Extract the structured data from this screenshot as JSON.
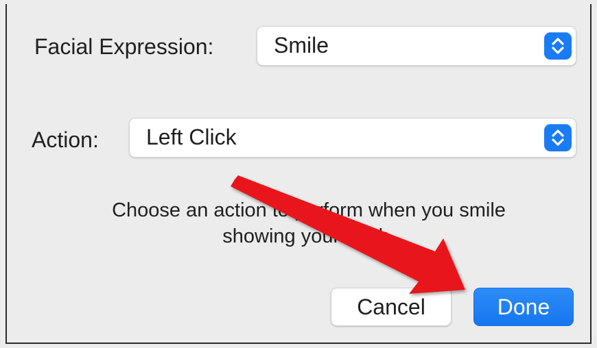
{
  "form": {
    "facial_expression_label": "Facial Expression:",
    "facial_expression_value": "Smile",
    "action_label": "Action:",
    "action_value": "Left Click",
    "description": "Choose an action to perform when you smile showing your teeth."
  },
  "buttons": {
    "cancel_label": "Cancel",
    "done_label": "Done"
  },
  "colors": {
    "accent": "#1a7cf5",
    "annotation_arrow": "#e8141b",
    "background": "#ececec"
  }
}
